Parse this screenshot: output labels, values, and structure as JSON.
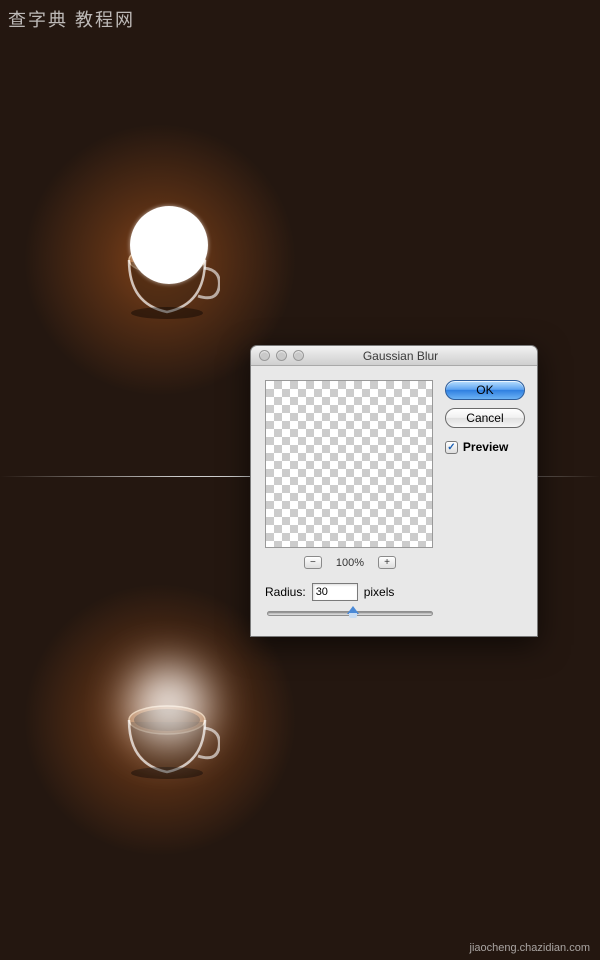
{
  "watermark": {
    "top": "查字典 教程网",
    "bottom": "jiaocheng.chazidian.com"
  },
  "dialog": {
    "title": "Gaussian Blur",
    "zoom": {
      "out": "−",
      "value": "100%",
      "in": "+"
    },
    "radius": {
      "label": "Radius:",
      "value": "30",
      "unit": "pixels"
    },
    "buttons": {
      "ok": "OK",
      "cancel": "Cancel"
    },
    "preview": {
      "label": "Preview",
      "checked": true,
      "mark": "✓"
    }
  }
}
